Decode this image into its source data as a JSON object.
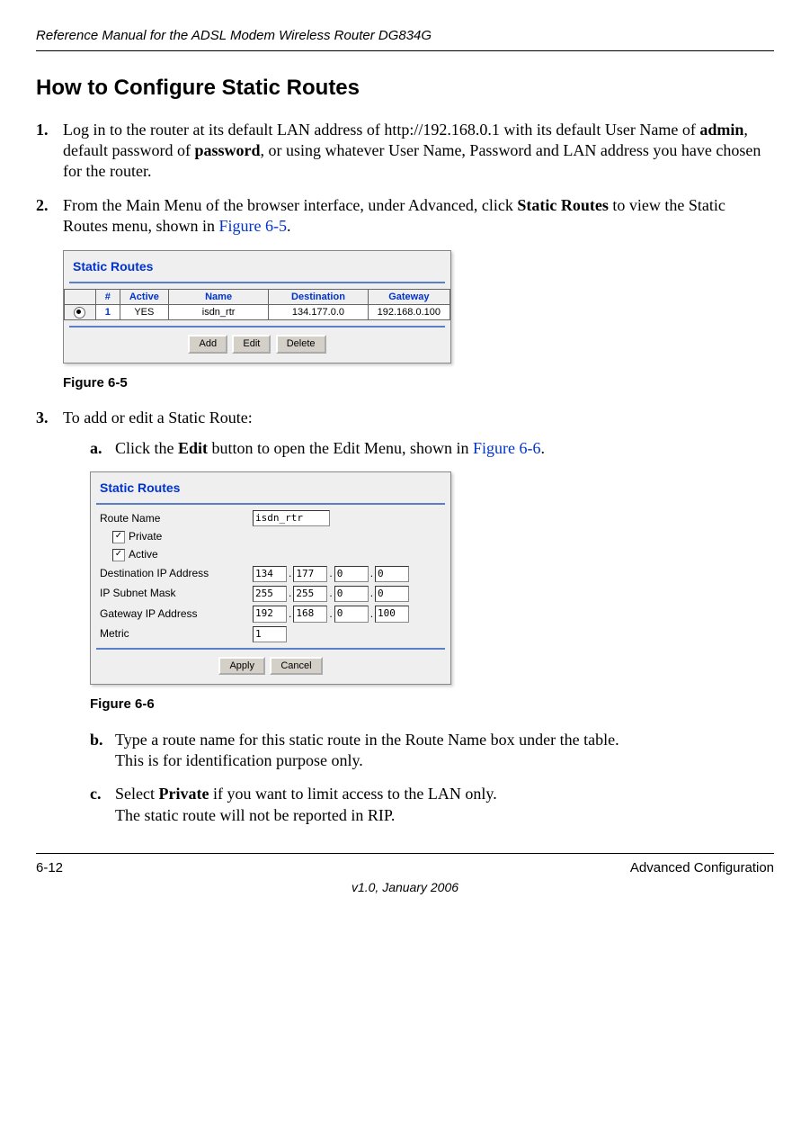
{
  "header": "Reference Manual for the ADSL Modem Wireless Router DG834G",
  "h2": "How to Configure Static Routes",
  "step1_a": "Log in to the router at its default LAN address of http://192.168.0.1 with its default User Name of ",
  "step1_bold1": "admin",
  "step1_b": ", default password of ",
  "step1_bold2": "password",
  "step1_c": ", or using whatever User Name, Password and LAN address you have chosen for the router.",
  "step2_a": "From the Main Menu of the browser interface, under Advanced, click ",
  "step2_bold": "Static Routes",
  "step2_b": " to view the Static Routes menu, shown in ",
  "step2_link": "Figure 6-5",
  "step2_c": ".",
  "fig65": {
    "title": "Static Routes",
    "headers": [
      "",
      "#",
      "Active",
      "Name",
      "Destination",
      "Gateway"
    ],
    "row": [
      "1",
      "YES",
      "isdn_rtr",
      "134.177.0.0",
      "192.168.0.100"
    ],
    "buttons": [
      "Add",
      "Edit",
      "Delete"
    ]
  },
  "caption65": "Figure 6-5",
  "step3": "To add or edit a Static Route:",
  "step3a_a": "Click the ",
  "step3a_bold": "Edit",
  "step3a_b": " button to open the Edit Menu, shown in ",
  "step3a_link": "Figure 6-6",
  "step3a_c": ".",
  "fig66": {
    "title": "Static Routes",
    "route_name_label": "Route Name",
    "route_name_value": "isdn_rtr",
    "private_label": "Private",
    "active_label": "Active",
    "dest_label": "Destination IP Address",
    "dest": [
      "134",
      "177",
      "0",
      "0"
    ],
    "mask_label": "IP Subnet Mask",
    "mask": [
      "255",
      "255",
      "0",
      "0"
    ],
    "gw_label": "Gateway IP Address",
    "gw": [
      "192",
      "168",
      "0",
      "100"
    ],
    "metric_label": "Metric",
    "metric_value": "1",
    "buttons": [
      "Apply",
      "Cancel"
    ]
  },
  "caption66": "Figure 6-6",
  "step3b_line1": "Type a route name for this static route in the Route Name box under the table.",
  "step3b_line2": "This is for identification purpose only.",
  "step3c_a": "Select ",
  "step3c_bold": "Private",
  "step3c_b": " if you want to limit access to the LAN only.",
  "step3c_line2": "The static route will not be reported in RIP.",
  "footer_left": "6-12",
  "footer_right": "Advanced Configuration",
  "footer_center": "v1.0, January 2006"
}
